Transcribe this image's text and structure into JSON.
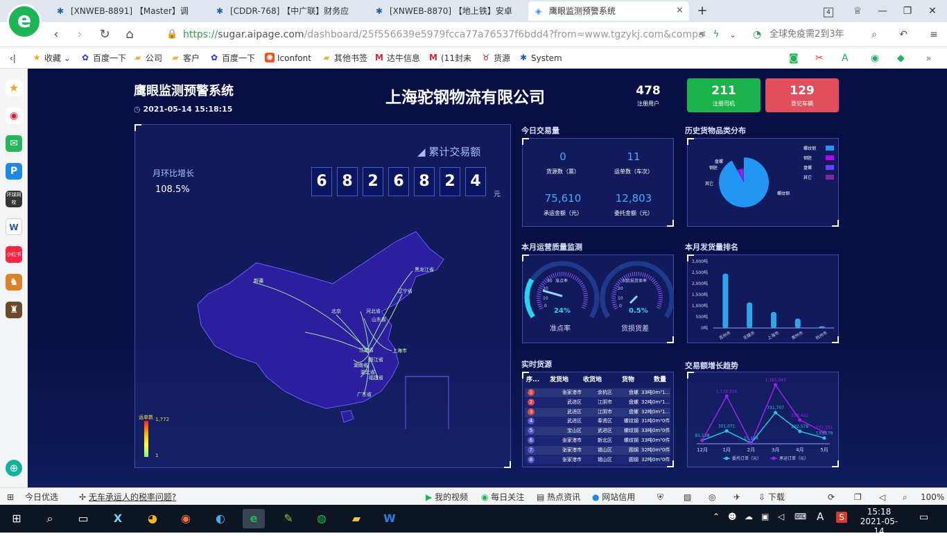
{
  "tabs": [
    {
      "label": "[XNWEB-8891] 【Master】调"
    },
    {
      "label": "[CDDR-768] 【中广联】财务应"
    },
    {
      "label": "[XNWEB-8870] 【地上铁】安卓"
    },
    {
      "label": "鹰眼监测预警系统"
    }
  ],
  "tab_count": "4",
  "address": {
    "protocol": "https://",
    "host": "sugar.aipage.com",
    "path": "/dashboard/25f556639e5979fcca77a76537f6bdd4?from=www.tgzykj.com&compa"
  },
  "search_hint": "全球免疫需2到3年",
  "bookmarks": [
    "收藏",
    "百度一下",
    "公司",
    "客户",
    "百度一下",
    "Iconfont",
    "其他书签",
    "达牛信息",
    "(11封未",
    "货源",
    "System"
  ],
  "sidebar_labels": {
    "news": "环球网校",
    "red": "小红书"
  },
  "dashboard": {
    "system_title": "鹰眼监测预警系统",
    "datetime": "2021-05-14 15:18:15",
    "company": "上海驼钢物流有限公司",
    "stats": {
      "users_value": "478",
      "users_label": "注册用户",
      "drivers_value": "211",
      "drivers_label": "注册司机",
      "vehicles_value": "129",
      "vehicles_label": "登记车辆"
    },
    "map_panel": {
      "cumulative_title": "累计交易额",
      "digits": [
        "6",
        "8",
        "2",
        "6",
        "8",
        "2",
        "4"
      ],
      "unit": "元",
      "mom_label": "月环比增长",
      "mom_value": "108.5%",
      "legend_title": "运单数",
      "legend_max": "1,772",
      "legend_min": "1",
      "provinces": [
        "黑龙江省",
        "辽宁省",
        "山东省",
        "江苏省",
        "上海市",
        "浙江省",
        "福建省",
        "广东省",
        "湖南省",
        "湖北省",
        "河北省",
        "北京",
        "新疆"
      ]
    },
    "today": {
      "title": "今日交易量",
      "cargo_value": "0",
      "cargo_label": "货源数（票）",
      "waybill_value": "11",
      "waybill_label": "运单数（车次）",
      "freight_value": "75,610",
      "freight_label": "承运金额（元）",
      "entrust_value": "12,803",
      "entrust_label": "委托金额（元）"
    },
    "history": {
      "title": "历史货物品类分布",
      "legend": [
        "螺纹钢",
        "钢胚",
        "盘螺",
        "其它"
      ],
      "labels": [
        "盘螺",
        "钢胚",
        "其它",
        "螺纹钢"
      ]
    },
    "quality": {
      "title": "本月运营质量监测",
      "gauge1": {
        "name": "准点率",
        "inner": "准点率",
        "value": "24%",
        "percent": 24
      },
      "gauge2": {
        "name": "货损货差",
        "inner": "货损货差率",
        "value": "0.5%",
        "percent": 0.5
      },
      "ticks": [
        "0",
        "10",
        "20",
        "30"
      ]
    },
    "shipment_rank": {
      "title": "本月发货量排名",
      "yticks": [
        "3,000吨",
        "2,500吨",
        "2,000吨",
        "1,500吨",
        "1,000吨",
        "500吨",
        "0吨"
      ]
    },
    "realtime": {
      "title": "实时货源",
      "headers": [
        "序...",
        "发货地",
        "收货地",
        "货物",
        "数量"
      ],
      "rows": [
        {
          "no": "1",
          "from": "张家港市",
          "to": "余杭区",
          "goods": "盘螺",
          "qty": "33吨0m³1..."
        },
        {
          "no": "2",
          "from": "武进区",
          "to": "江阴市",
          "goods": "盘螺",
          "qty": "32吨0m³1..."
        },
        {
          "no": "3",
          "from": "武进区",
          "to": "江阴市",
          "goods": "盘螺",
          "qty": "32吨0m³1..."
        },
        {
          "no": "4",
          "from": "武进区",
          "to": "奉贤区",
          "goods": "螺纹钢",
          "qty": "31吨0m³0件"
        },
        {
          "no": "5",
          "from": "宝山区",
          "to": "武进区",
          "goods": "螺纹钢",
          "qty": "33吨0m³0件"
        },
        {
          "no": "6",
          "from": "张家港市",
          "to": "新北区",
          "goods": "螺纹钢",
          "qty": "33吨0m³0件"
        },
        {
          "no": "7",
          "from": "张家港市",
          "to": "锡山区",
          "goods": "圆钢",
          "qty": "32吨0m³0件"
        },
        {
          "no": "8",
          "from": "张家港市",
          "to": "锡山区",
          "goods": "圆钢",
          "qty": "32吨0m³0件"
        }
      ]
    },
    "trend": {
      "title": "交易额增长趋势"
    }
  },
  "chart_data": [
    {
      "type": "bar",
      "categories": [
        "苏州市",
        "无锡市",
        "上海市",
        "常州市",
        "杭州市"
      ],
      "values": [
        2450,
        1150,
        720,
        420,
        80
      ],
      "ylim": [
        0,
        3000
      ]
    },
    {
      "type": "line",
      "categories": [
        "12月",
        "1月",
        "2月",
        "3月",
        "4月",
        "5月"
      ],
      "series": [
        {
          "name": "委托订单（元）",
          "values": [
            81138,
            301071,
            15164,
            731707,
            292578,
            135176
          ],
          "color": "#22c7e8"
        },
        {
          "name": "承运订单（元）",
          "values": [
            81138,
            1119556,
            15164,
            1383043,
            558422,
            271151
          ],
          "color": "#a020f0"
        }
      ],
      "data_labels": {
        "series0": [
          "81,138",
          "301,071",
          "15,164",
          "731,707",
          "292,578",
          "135,176"
        ],
        "series1": [
          "",
          "1,119,556",
          "",
          "1,383,043",
          "558,422",
          "271,151"
        ]
      },
      "ylim": [
        0,
        1500000
      ]
    },
    {
      "type": "pie",
      "categories": [
        "螺纹钢",
        "钢胚",
        "盘螺",
        "其它"
      ],
      "values": [
        92,
        3,
        3,
        2
      ],
      "colors": [
        "#2196f3",
        "#b000ff",
        "#6a3dff",
        "#7a2aa0"
      ]
    }
  ],
  "statusbar": [
    "今日优选",
    "无车承运人的税率问题?",
    "我的视频",
    "每日关注",
    "热点资讯",
    "网站信用",
    "下载",
    "100%"
  ],
  "clock": {
    "time": "15:18",
    "date": "2021-05-14"
  }
}
